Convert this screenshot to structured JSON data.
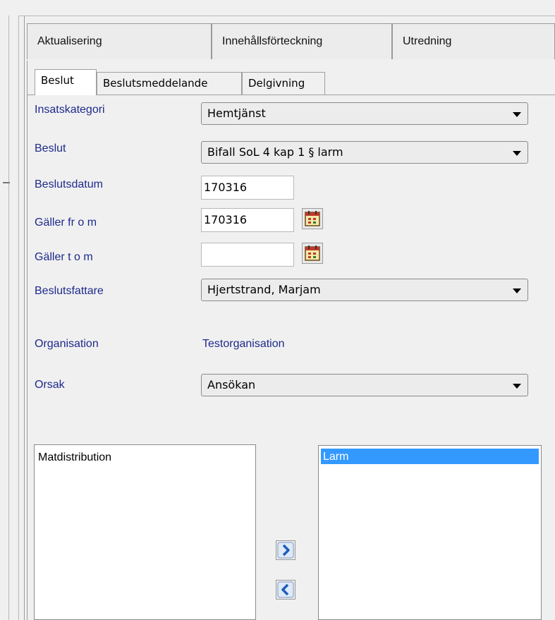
{
  "outer_tabs": [
    "Aktualisering",
    "Innehållsförteckning",
    "Utredning"
  ],
  "inner_tabs": [
    "Beslut",
    "Beslutsmeddelande",
    "Delgivning"
  ],
  "form": {
    "insatskategori": {
      "label": "Insatskategori",
      "value": "Hemtjänst"
    },
    "beslut": {
      "label": "Beslut",
      "value": "Bifall SoL 4 kap 1 § larm"
    },
    "beslutsdatum": {
      "label": "Beslutsdatum",
      "value": "170316"
    },
    "galler_from": {
      "label": "Gäller fr o m",
      "value": "170316"
    },
    "galler_tom": {
      "label": "Gäller t o m",
      "value": ""
    },
    "beslutsfattare": {
      "label": "Beslutsfattare",
      "value": "Hjertstrand, Marjam"
    },
    "organisation": {
      "label": "Organisation",
      "value": "Testorganisation"
    },
    "orsak": {
      "label": "Orsak",
      "value": "Ansökan"
    }
  },
  "available_list": [
    "Matdistribution"
  ],
  "selected_list": [
    "Larm"
  ],
  "icons": {
    "calendar": "calendar-icon",
    "move_right": "chevron-right-icon",
    "move_left": "chevron-left-icon"
  },
  "colors": {
    "label_text": "#1e2a8c",
    "selection_highlight": "#3399ff",
    "arrow_blue": "#1e5fb8"
  }
}
